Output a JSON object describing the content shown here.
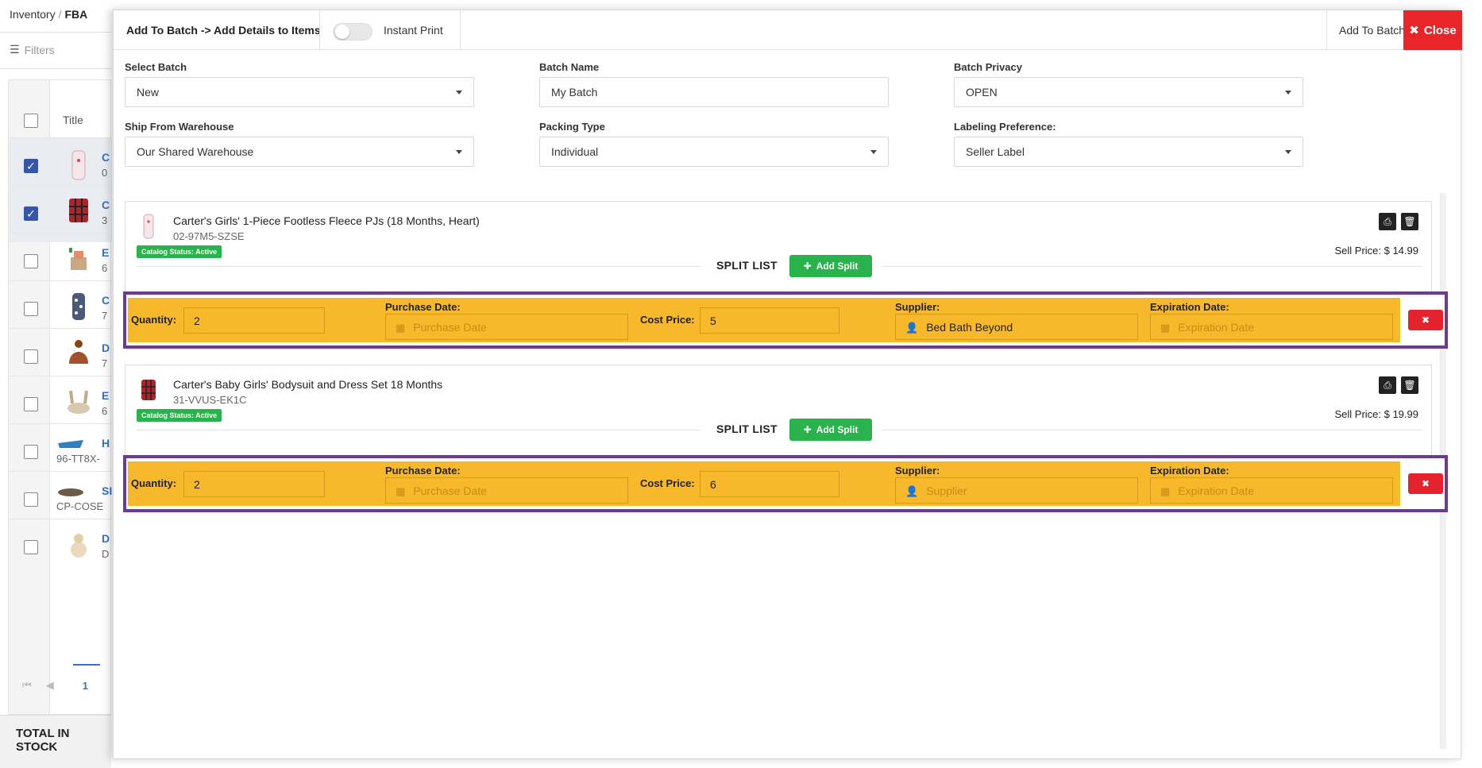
{
  "background": {
    "breadcrumb": {
      "first": "Inventory",
      "separator": "/",
      "current": "FBA"
    },
    "filters_label": "Filters",
    "table_head_title": "Title",
    "rows": [
      {
        "link": "C",
        "sub": "0",
        "checked": true
      },
      {
        "link": "C",
        "sub": "3",
        "checked": true
      },
      {
        "link": "E",
        "sub": "6",
        "checked": false
      },
      {
        "link": "C",
        "sub": "7",
        "checked": false
      },
      {
        "link": "D",
        "sub": "7",
        "checked": false
      },
      {
        "link": "E",
        "sub": "6",
        "checked": false
      },
      {
        "link": "H",
        "sub": "96-TT8X-",
        "checked": false
      },
      {
        "link": "SI",
        "sub": "CP-COSE",
        "checked": false
      },
      {
        "link": "D",
        "sub": "D",
        "checked": false
      }
    ],
    "pager": {
      "first": "⏮",
      "prev": "◀",
      "page": "1"
    },
    "total_in_stock": "TOTAL IN STOCK"
  },
  "modal": {
    "title": "Add To Batch -> Add Details to Items",
    "instant_print_label": "Instant Print",
    "add_to_batch_label": "Add To Batch",
    "close_label": "Close",
    "form": {
      "select_batch": {
        "label": "Select Batch",
        "value": "New"
      },
      "batch_name": {
        "label": "Batch Name",
        "value": "My Batch"
      },
      "batch_privacy": {
        "label": "Batch Privacy",
        "value": "OPEN"
      },
      "ship_from": {
        "label": "Ship From Warehouse",
        "value": "Our Shared Warehouse"
      },
      "packing_type": {
        "label": "Packing Type",
        "value": "Individual"
      },
      "labeling": {
        "label": "Labeling Preference:",
        "value": "Seller Label"
      }
    },
    "items": [
      {
        "name": "Carter's Girls' 1-Piece Footless Fleece PJs (18 Months, Heart)",
        "sku": "02-97M5-SZSE",
        "status": "Catalog Status: Active",
        "sell_price": "Sell Price: $ 14.99",
        "split_list": "SPLIT LIST",
        "add_split": "Add Split",
        "split": {
          "quantity_label": "Quantity:",
          "quantity": "2",
          "purchase_label": "Purchase Date:",
          "purchase_placeholder": "Purchase Date",
          "cost_label": "Cost Price:",
          "cost": "5",
          "supplier_label": "Supplier:",
          "supplier": "Bed Bath Beyond",
          "expiration_label": "Expiration Date:",
          "expiration_placeholder": "Expiration Date"
        }
      },
      {
        "name": "Carter's Baby Girls' Bodysuit and Dress Set 18 Months",
        "sku": "31-VVUS-EK1C",
        "status": "Catalog Status: Active",
        "sell_price": "Sell Price: $ 19.99",
        "split_list": "SPLIT LIST",
        "add_split": "Add Split",
        "split": {
          "quantity_label": "Quantity:",
          "quantity": "2",
          "purchase_label": "Purchase Date:",
          "purchase_placeholder": "Purchase Date",
          "cost_label": "Cost Price:",
          "cost": "6",
          "supplier_label": "Supplier:",
          "supplier_placeholder": "Supplier",
          "expiration_label": "Expiration Date:",
          "expiration_placeholder": "Expiration Date"
        }
      }
    ]
  },
  "colors": {
    "close_red": "#e8262a",
    "green": "#2ab24c",
    "highlight_purple": "#6c3a93",
    "split_orange": "#f7b92b",
    "link_blue": "#3a70c0"
  }
}
